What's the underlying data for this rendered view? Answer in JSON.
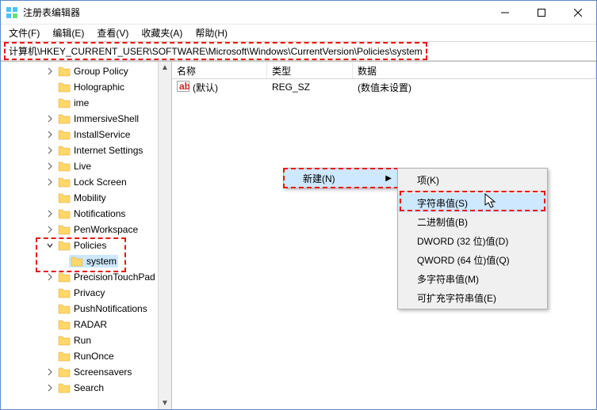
{
  "window": {
    "title": "注册表编辑器"
  },
  "menu": {
    "file": "文件(F)",
    "edit": "编辑(E)",
    "view": "查看(V)",
    "favorites": "收藏夹(A)",
    "help": "帮助(H)"
  },
  "address": {
    "path": "计算机\\HKEY_CURRENT_USER\\SOFTWARE\\Microsoft\\Windows\\CurrentVersion\\Policies\\system"
  },
  "tree": {
    "items": [
      {
        "label": "Group Policy",
        "depth": 3,
        "toggle": ">"
      },
      {
        "label": "Holographic",
        "depth": 3,
        "toggle": ""
      },
      {
        "label": "ime",
        "depth": 3,
        "toggle": ""
      },
      {
        "label": "ImmersiveShell",
        "depth": 3,
        "toggle": ">"
      },
      {
        "label": "InstallService",
        "depth": 3,
        "toggle": ">"
      },
      {
        "label": "Internet Settings",
        "depth": 3,
        "toggle": ">"
      },
      {
        "label": "Live",
        "depth": 3,
        "toggle": ">"
      },
      {
        "label": "Lock Screen",
        "depth": 3,
        "toggle": ">"
      },
      {
        "label": "Mobility",
        "depth": 3,
        "toggle": ""
      },
      {
        "label": "Notifications",
        "depth": 3,
        "toggle": ">"
      },
      {
        "label": "PenWorkspace",
        "depth": 3,
        "toggle": ">"
      },
      {
        "label": "Policies",
        "depth": 3,
        "toggle": "v",
        "expanded": true
      },
      {
        "label": "system",
        "depth": 4,
        "toggle": "",
        "selected": true
      },
      {
        "label": "PrecisionTouchPad",
        "depth": 3,
        "toggle": ">"
      },
      {
        "label": "Privacy",
        "depth": 3,
        "toggle": ""
      },
      {
        "label": "PushNotifications",
        "depth": 3,
        "toggle": ""
      },
      {
        "label": "RADAR",
        "depth": 3,
        "toggle": ""
      },
      {
        "label": "Run",
        "depth": 3,
        "toggle": ""
      },
      {
        "label": "RunOnce",
        "depth": 3,
        "toggle": ""
      },
      {
        "label": "Screensavers",
        "depth": 3,
        "toggle": ">"
      },
      {
        "label": "Search",
        "depth": 3,
        "toggle": ">"
      }
    ]
  },
  "list": {
    "columns": {
      "name": "名称",
      "type": "类型",
      "data": "数据"
    },
    "rows": [
      {
        "name": "(默认)",
        "type": "REG_SZ",
        "data": "(数值未设置)"
      }
    ]
  },
  "context_menu": {
    "new_label": "新建(N)",
    "submenu": {
      "key": "项(K)",
      "string": "字符串值(S)",
      "binary": "二进制值(B)",
      "dword": "DWORD (32 位)值(D)",
      "qword": "QWORD (64 位)值(Q)",
      "multi": "多字符串值(M)",
      "expand": "可扩充字符串值(E)"
    }
  }
}
